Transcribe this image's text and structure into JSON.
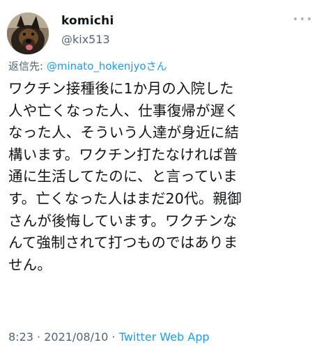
{
  "user": {
    "display_name": "komichi",
    "handle": "@kix513"
  },
  "reply": {
    "prefix": "返信先: ",
    "mention": "@minato_hokenjyo",
    "suffix": "さん"
  },
  "tweet": {
    "lines": [
      "ワクチン接種後に1か月の入院した",
      "人や亡くなった人、仕事復帰が遅く",
      "なった人、そういう人達が身近に結",
      "構います。ワクチン打たなければ普",
      "通に生活してたのに、と言っていま",
      "す。亡くなった人はまだ20代。親御",
      "さんが後悔しています。ワクチンな",
      "んて強制されて打つものではありま",
      "せん。"
    ]
  },
  "meta": {
    "time": "8:23",
    "separator": " · ",
    "date": "2021/08/10",
    "source": "Twitter Web App"
  },
  "icons": {
    "more": "more-horizontal-icon",
    "avatar": "dog-avatar"
  },
  "colors": {
    "link": "#1d9bf0",
    "secondary_text": "#536471",
    "primary_text": "#0f1419"
  }
}
